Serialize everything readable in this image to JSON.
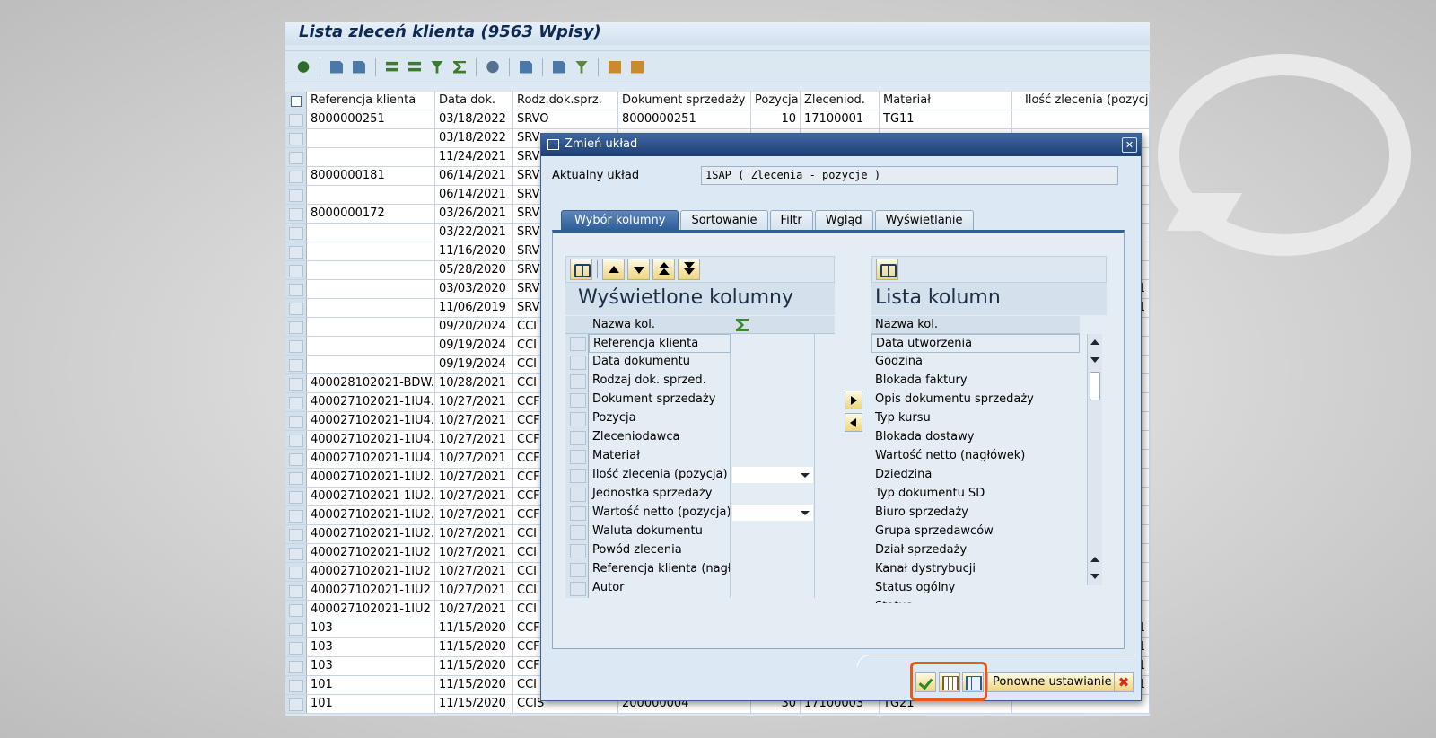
{
  "window": {
    "title": "Lista zleceń klienta (9563 Wpisy)"
  },
  "grid": {
    "columns": [
      "Referencja klienta",
      "Data dok.",
      "Rodz.dok.sprz.",
      "Dokument sprzedaży",
      "Pozycja",
      "Zleceniod.",
      "Materiał",
      "Ilość zlecenia (pozycja)"
    ],
    "rows": [
      [
        "8000000251",
        "03/18/2022",
        "SRVO",
        "8000000251",
        "10",
        "17100001",
        "TG11",
        ""
      ],
      [
        "",
        "03/18/2022",
        "SRV",
        "",
        "",
        "",
        "",
        ""
      ],
      [
        "",
        "11/24/2021",
        "SRV",
        "",
        "",
        "",
        "",
        ""
      ],
      [
        "8000000181",
        "06/14/2021",
        "SRV",
        "",
        "",
        "",
        "",
        ""
      ],
      [
        "",
        "06/14/2021",
        "SRV",
        "",
        "",
        "",
        "",
        ""
      ],
      [
        "8000000172",
        "03/26/2021",
        "SRV",
        "",
        "",
        "",
        "",
        ""
      ],
      [
        "",
        "03/22/2021",
        "SRV",
        "",
        "",
        "",
        "",
        ""
      ],
      [
        "",
        "11/16/2020",
        "SRV",
        "",
        "",
        "",
        "",
        ""
      ],
      [
        "",
        "05/28/2020",
        "SRV",
        "",
        "",
        "",
        "",
        ""
      ],
      [
        "",
        "03/03/2020",
        "SRV",
        "",
        "",
        "",
        "",
        "1"
      ],
      [
        "",
        "11/06/2019",
        "SRV",
        "",
        "",
        "",
        "",
        "1"
      ],
      [
        "",
        "09/20/2024",
        "CCI",
        "",
        "",
        "",
        "",
        ""
      ],
      [
        "",
        "09/19/2024",
        "CCI",
        "",
        "",
        "",
        "",
        ""
      ],
      [
        "",
        "09/19/2024",
        "CCI",
        "",
        "",
        "",
        "",
        ""
      ],
      [
        "400028102021-BDW...",
        "10/28/2021",
        "CCI",
        "",
        "",
        "",
        "",
        ""
      ],
      [
        "400027102021-1IU4.1",
        "10/27/2021",
        "CCF",
        "",
        "",
        "",
        "",
        ""
      ],
      [
        "400027102021-1IU4.1",
        "10/27/2021",
        "CCF",
        "",
        "",
        "",
        "",
        ""
      ],
      [
        "400027102021-1IU4.1",
        "10/27/2021",
        "CCF",
        "",
        "",
        "",
        "",
        ""
      ],
      [
        "400027102021-1IU4.1",
        "10/27/2021",
        "CCF",
        "",
        "",
        "",
        "",
        ""
      ],
      [
        "400027102021-1IU2.1",
        "10/27/2021",
        "CCF",
        "",
        "",
        "",
        "",
        ""
      ],
      [
        "400027102021-1IU2.1",
        "10/27/2021",
        "CCF",
        "",
        "",
        "",
        "",
        ""
      ],
      [
        "400027102021-1IU2.1",
        "10/27/2021",
        "CCF",
        "",
        "",
        "",
        "",
        ""
      ],
      [
        "400027102021-1IU2.1",
        "10/27/2021",
        "CCI",
        "",
        "",
        "",
        "",
        ""
      ],
      [
        "400027102021-1IU2",
        "10/27/2021",
        "CCI",
        "",
        "",
        "",
        "",
        ""
      ],
      [
        "400027102021-1IU2",
        "10/27/2021",
        "CCI",
        "",
        "",
        "",
        "",
        ""
      ],
      [
        "400027102021-1IU2",
        "10/27/2021",
        "CCI",
        "",
        "",
        "",
        "",
        ""
      ],
      [
        "400027102021-1IU2",
        "10/27/2021",
        "CCI",
        "",
        "",
        "",
        "",
        ""
      ],
      [
        "103",
        "11/15/2020",
        "CCF",
        "",
        "",
        "",
        "",
        "1"
      ],
      [
        "103",
        "11/15/2020",
        "CCF",
        "",
        "",
        "",
        "",
        "1"
      ],
      [
        "103",
        "11/15/2020",
        "CCF",
        "",
        "",
        "",
        "",
        "1"
      ],
      [
        "101",
        "11/15/2020",
        "CCI",
        "",
        "",
        "",
        "",
        "1"
      ],
      [
        "101",
        "11/15/2020",
        "CCIS",
        "200000004",
        "30",
        "17100003",
        "TG21",
        ""
      ]
    ]
  },
  "dialog": {
    "title": "Zmień układ",
    "current_layout_label": "Aktualny układ",
    "current_layout_value": "1SAP ( Zlecenia - pozycje )",
    "tabs": [
      "Wybór kolumny",
      "Sortowanie",
      "Filtr",
      "Wgląd",
      "Wyświetlanie"
    ],
    "active_tab": "Wybór kolumny",
    "displayed": {
      "title": "Wyświetlone kolumny",
      "col_header": "Nazwa kol.",
      "items": [
        "Referencja klienta",
        "Data dokumentu",
        "Rodzaj dok. sprzed.",
        "Dokument sprzedaży",
        "Pozycja",
        "Zleceniodawca",
        "Materiał",
        "Ilość zlecenia (pozycja)",
        "Jednostka sprzedaży",
        "Wartość netto (pozycja)",
        "Waluta dokumentu",
        "Powód zlecenia",
        "Referencja klienta (nagł...",
        "Autor"
      ],
      "aggregation_rows": [
        7,
        9
      ]
    },
    "available": {
      "title": "Lista kolumn",
      "col_header": "Nazwa kol.",
      "items": [
        "Data utworzenia",
        "Godzina",
        "Blokada faktury",
        "Opis dokumentu sprzedaży",
        "Typ kursu",
        "Blokada dostawy",
        "Wartość netto (nagłówek)",
        "Dziedzina",
        "Typ dokumentu SD",
        "Biuro sprzedaży",
        "Grupa sprzedawców",
        "Dział sprzedaży",
        "Kanał dystrybucji",
        "Status ogólny",
        "Status..."
      ]
    },
    "footer": {
      "reset_label": "Ponowne ustawianie"
    }
  },
  "colors": {
    "accent": "#2f5e99",
    "highlight": "#e75a14",
    "title_bar": "#1d3f72"
  }
}
